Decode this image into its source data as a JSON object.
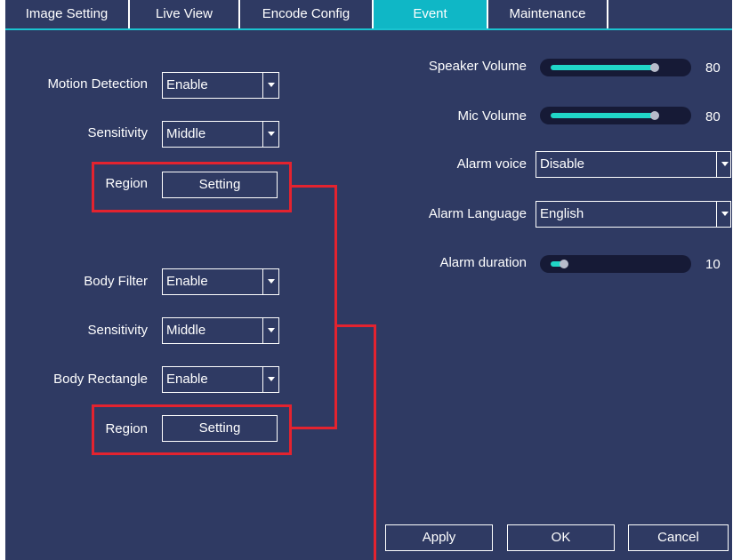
{
  "tabs": [
    {
      "label": "Image Setting"
    },
    {
      "label": "Live View"
    },
    {
      "label": "Encode Config"
    },
    {
      "label": "Event"
    },
    {
      "label": "Maintenance"
    }
  ],
  "left": {
    "motion_detection": {
      "label": "Motion Detection",
      "value": "Enable"
    },
    "sensitivity_1": {
      "label": "Sensitivity",
      "value": "Middle"
    },
    "region_1": {
      "label": "Region",
      "button": "Setting"
    },
    "body_filter": {
      "label": "Body Filter",
      "value": "Enable"
    },
    "sensitivity_2": {
      "label": "Sensitivity",
      "value": "Middle"
    },
    "body_rectangle": {
      "label": "Body Rectangle",
      "value": "Enable"
    },
    "region_2": {
      "label": "Region",
      "button": "Setting"
    }
  },
  "right": {
    "speaker_volume": {
      "label": "Speaker Volume",
      "value": "80",
      "level": 0.8
    },
    "mic_volume": {
      "label": "Mic Volume",
      "value": "80",
      "level": 0.8
    },
    "alarm_voice": {
      "label": "Alarm voice",
      "value": "Disable"
    },
    "alarm_language": {
      "label": "Alarm Language",
      "value": "English"
    },
    "alarm_duration": {
      "label": "Alarm duration",
      "value": "10",
      "level": 0.1
    }
  },
  "footer": {
    "apply": "Apply",
    "ok": "OK",
    "cancel": "Cancel"
  },
  "colors": {
    "panel": "#2f3a63",
    "active_tab": "#0fb7c6",
    "slider_fill": "#20d6c7",
    "highlight": "#e3232f"
  }
}
